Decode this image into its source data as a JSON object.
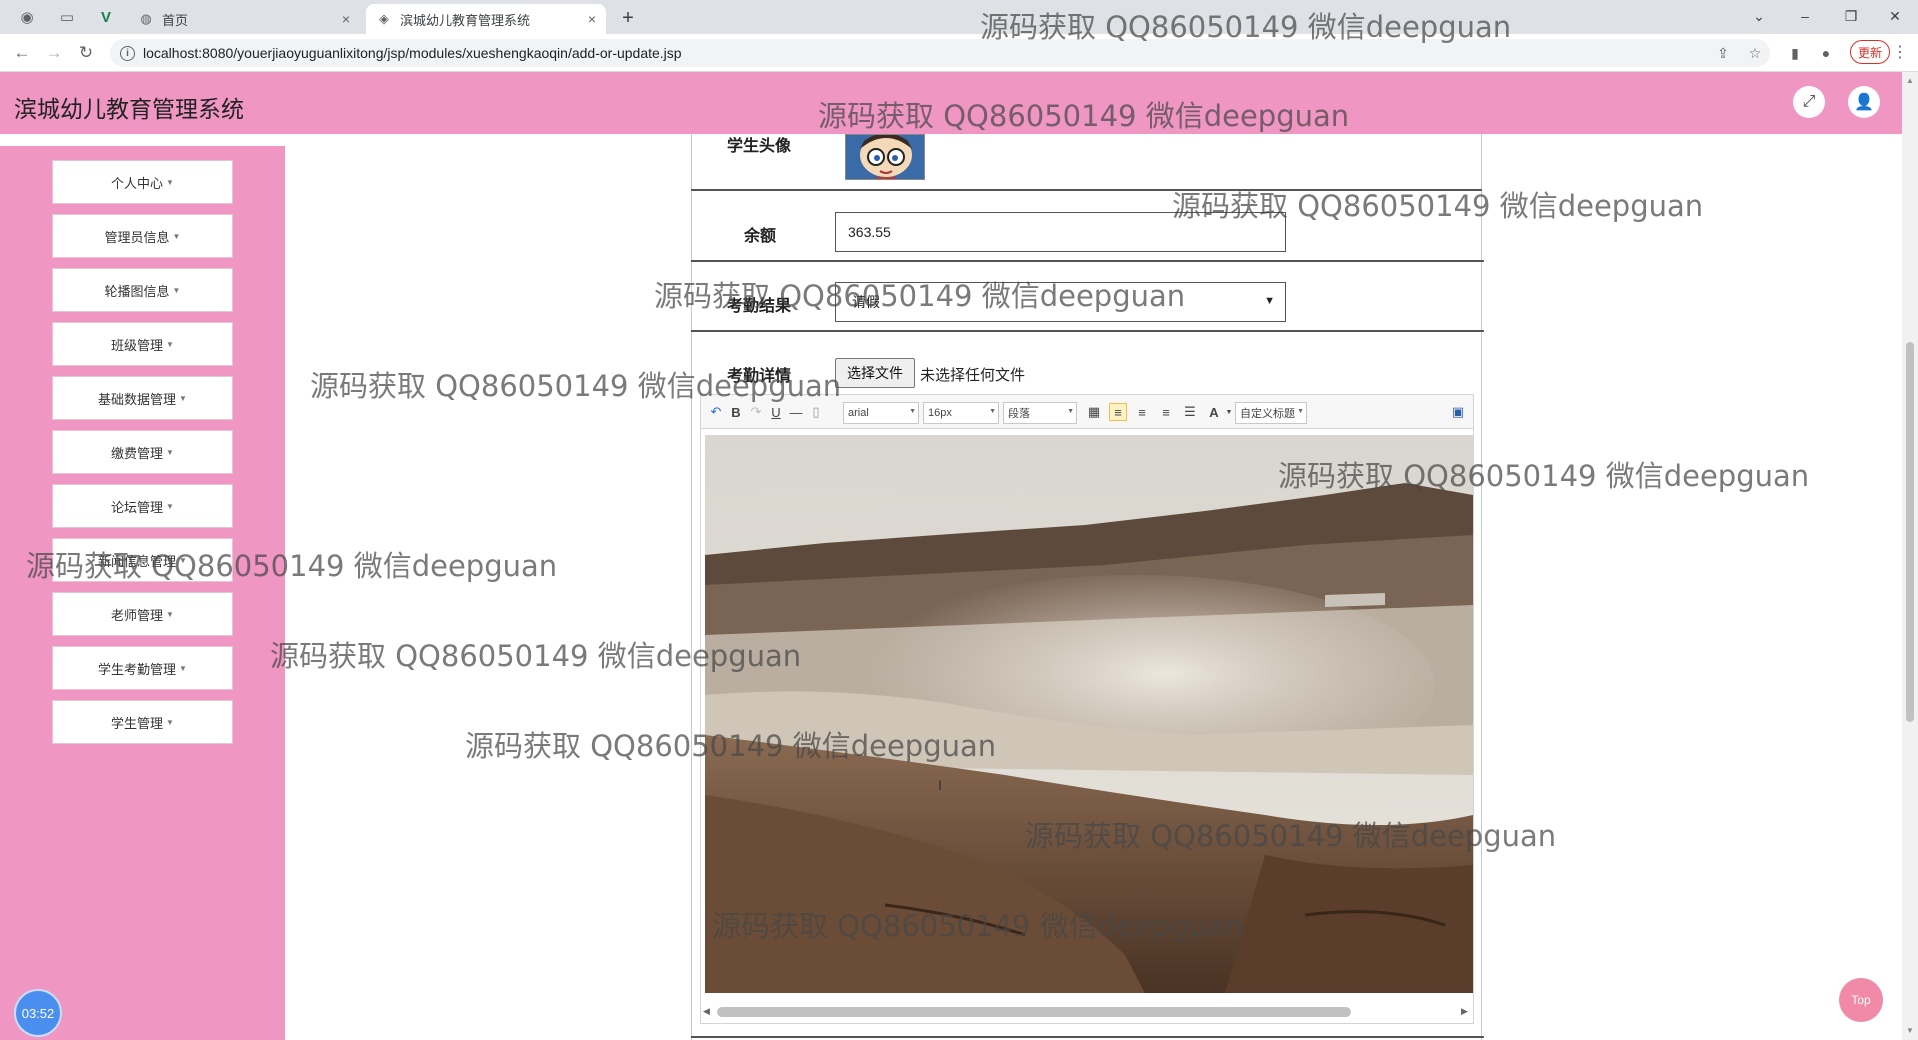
{
  "browser": {
    "tabs": [
      {
        "title": "首页",
        "close": "×"
      },
      {
        "title": "滨城幼儿教育管理系统",
        "close": "×"
      }
    ],
    "new_tab": "+",
    "url": "localhost:8080/youerjiaoyuguanlixitong/jsp/modules/xueshengkaoqin/add-or-update.jsp",
    "update_label": "更新"
  },
  "header": {
    "title": "滨城幼儿教育管理系统"
  },
  "sidebar": {
    "items": [
      {
        "label": "个人中心"
      },
      {
        "label": "管理员信息"
      },
      {
        "label": "轮播图信息"
      },
      {
        "label": "班级管理"
      },
      {
        "label": "基础数据管理"
      },
      {
        "label": "缴费管理"
      },
      {
        "label": "论坛管理"
      },
      {
        "label": "新闻信息管理"
      },
      {
        "label": "老师管理"
      },
      {
        "label": "学生考勤管理"
      },
      {
        "label": "学生管理"
      }
    ]
  },
  "form": {
    "avatar_label": "学生头像",
    "balance_label": "余额",
    "balance_value": "363.55",
    "result_label": "考勤结果",
    "result_value": "请假",
    "detail_label": "考勤详情",
    "file_button": "选择文件",
    "file_status": "未选择任何文件"
  },
  "editor": {
    "font": "arial",
    "size": "16px",
    "paragraph": "段落",
    "custom_heading": "自定义标题"
  },
  "timer": "03:52",
  "top_button": "Top",
  "watermark": "源码获取 QQ86050149 微信deepguan"
}
